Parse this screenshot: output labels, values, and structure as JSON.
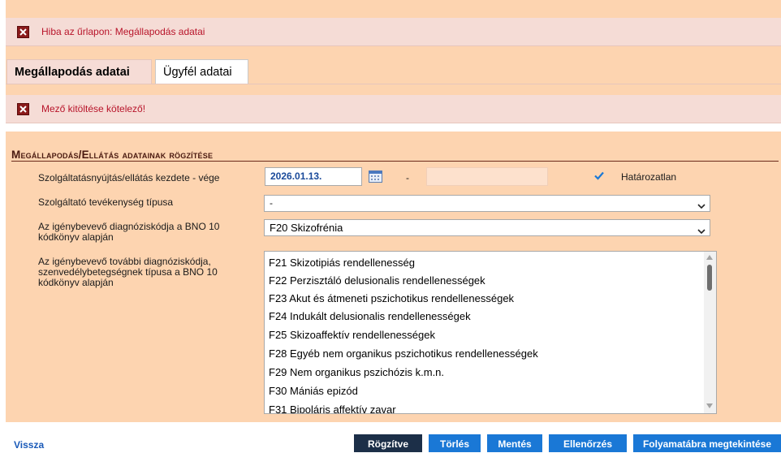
{
  "errors": {
    "form_error": "Hiba az űrlapon: Megállapodás adatai",
    "field_error": "Mező kitöltése kötelező!"
  },
  "tabs": [
    {
      "label": "Megállapodás adatai",
      "active": true
    },
    {
      "label": "Ügyfél adatai",
      "active": false
    }
  ],
  "section": {
    "title": "Megállapodás/Ellátás adatainak rögzítése"
  },
  "fields": {
    "date_range": {
      "label": "Szolgáltatásnyújtás/ellátás kezdete - vége",
      "start_value": "2026.01.13.",
      "separator": "-",
      "end_value": "",
      "indefinite_label": "Határozatlan",
      "indefinite_checked": true
    },
    "activity_type": {
      "label": "Szolgáltató tevékenység típusa",
      "value": "-"
    },
    "main_diagnosis": {
      "label_line1": "Az igénybevevő diagnóziskódja a BNO 10",
      "label_line2": "kódkönyv alapján",
      "value": "F20 Skizofrénia"
    },
    "other_diagnoses": {
      "label_line1": "Az igénybevevő további diagnóziskódja,",
      "label_line2": "szenvedélybetegségnek típusa a BNO 10",
      "label_line3": "kódkönyv alapján",
      "options": [
        "F21 Skizotipiás rendellenesség",
        "F22 Perzisztáló delusionalis rendellenességek",
        "F23 Akut és átmeneti pszichotikus rendellenességek",
        "F24 Indukált delusionalis rendellenességek",
        "F25 Skizoaffektív rendellenességek",
        "F28 Egyéb nem organikus pszichotikus rendellenességek",
        "F29 Nem organikus pszichózis k.m.n.",
        "F30 Mániás epizód",
        "F31 Bipoláris affektív zavar"
      ]
    }
  },
  "footer": {
    "back_link": "Vissza",
    "buttons": {
      "recorded": "Rögzítve",
      "delete": "Törlés",
      "save": "Mentés",
      "check": "Ellenőrzés",
      "flowchart": "Folyamatábra megtekintése"
    }
  },
  "colors": {
    "panel_bg": "#fdd4b0",
    "error_bg": "#f5dcd6",
    "error_text": "#b8142a",
    "button_blue": "#1a78d6",
    "button_dark": "#1c2f48",
    "link_blue": "#1a5ab8"
  }
}
